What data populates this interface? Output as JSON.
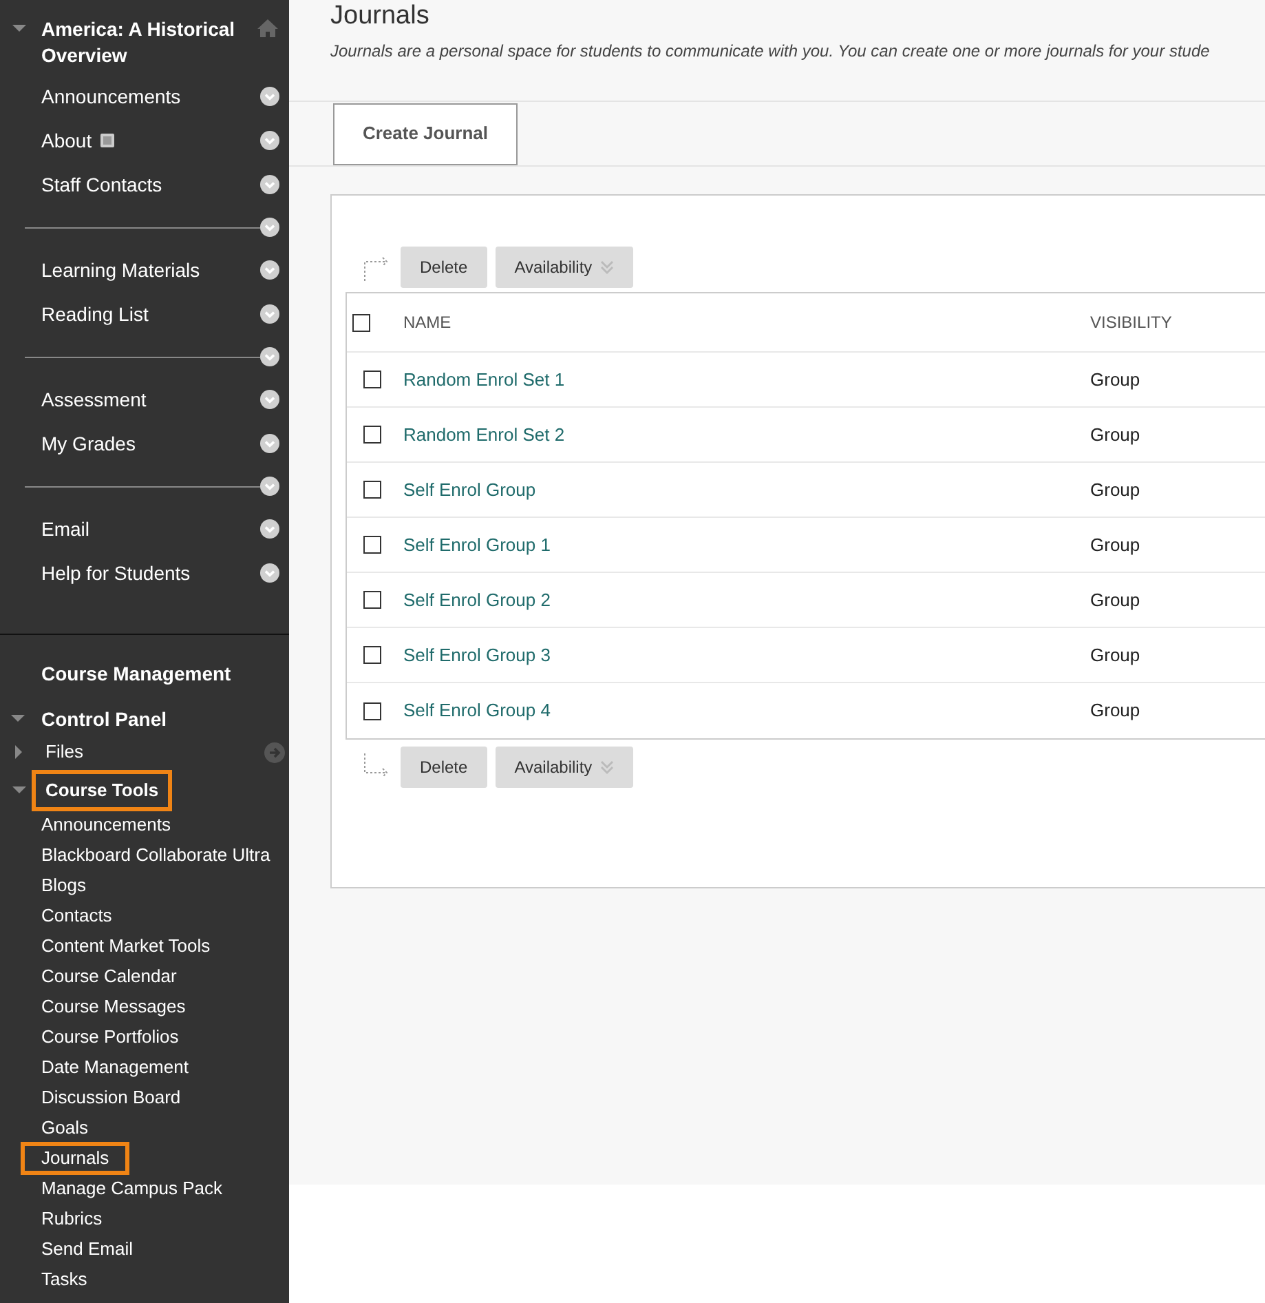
{
  "course_menu": {
    "title": "America: A Historical Overview",
    "expanded": true,
    "items": [
      {
        "kind": "link",
        "label": "Announcements"
      },
      {
        "kind": "link_with_icon",
        "label": "About"
      },
      {
        "kind": "link",
        "label": "Staff Contacts"
      },
      {
        "kind": "divider"
      },
      {
        "kind": "link",
        "label": "Learning Materials"
      },
      {
        "kind": "link",
        "label": "Reading List"
      },
      {
        "kind": "divider"
      },
      {
        "kind": "link",
        "label": "Assessment"
      },
      {
        "kind": "link",
        "label": "My Grades"
      },
      {
        "kind": "divider"
      },
      {
        "kind": "link",
        "label": "Email"
      },
      {
        "kind": "link",
        "label": "Help for Students"
      }
    ]
  },
  "management": {
    "title": "Course Management",
    "control_panel": {
      "label": "Control Panel",
      "expanded": true,
      "items": [
        {
          "label": "Files",
          "expanded": false,
          "highlighted": false
        },
        {
          "label": "Course Tools",
          "expanded": true,
          "highlighted": true,
          "children": [
            {
              "label": "Announcements",
              "highlighted": false
            },
            {
              "label": "Blackboard Collaborate Ultra",
              "highlighted": false
            },
            {
              "label": "Blogs",
              "highlighted": false
            },
            {
              "label": "Contacts",
              "highlighted": false
            },
            {
              "label": "Content Market Tools",
              "highlighted": false
            },
            {
              "label": "Course Calendar",
              "highlighted": false
            },
            {
              "label": "Course Messages",
              "highlighted": false
            },
            {
              "label": "Course Portfolios",
              "highlighted": false
            },
            {
              "label": "Date Management",
              "highlighted": false
            },
            {
              "label": "Discussion Board",
              "highlighted": false
            },
            {
              "label": "Goals",
              "highlighted": false
            },
            {
              "label": "Journals",
              "highlighted": true
            },
            {
              "label": "Manage Campus Pack",
              "highlighted": false
            },
            {
              "label": "Rubrics",
              "highlighted": false
            },
            {
              "label": "Send Email",
              "highlighted": false
            },
            {
              "label": "Tasks",
              "highlighted": false
            }
          ]
        }
      ]
    }
  },
  "page": {
    "title": "Journals",
    "description": "Journals are a personal space for students to communicate with you. You can create one or more journals for your stude",
    "create_button": "Create Journal"
  },
  "top_actions": [
    "Delete",
    "Availability"
  ],
  "table": {
    "select_all_checked": false,
    "columns": [
      "NAME",
      "VISIBILITY"
    ],
    "rows": [
      {
        "name": "Random Enrol Set 1",
        "visibility": "Group",
        "checked": false
      },
      {
        "name": "Random Enrol Set 2",
        "visibility": "Group",
        "checked": false
      },
      {
        "name": "Self Enrol Group",
        "visibility": "Group",
        "checked": false
      },
      {
        "name": "Self Enrol Group 1",
        "visibility": "Group",
        "checked": false
      },
      {
        "name": "Self Enrol Group 2",
        "visibility": "Group",
        "checked": false
      },
      {
        "name": "Self Enrol Group 3",
        "visibility": "Group",
        "checked": false
      },
      {
        "name": "Self Enrol Group 4",
        "visibility": "Group",
        "checked": false
      }
    ]
  },
  "bottom_actions": [
    "Delete",
    "Availability"
  ]
}
